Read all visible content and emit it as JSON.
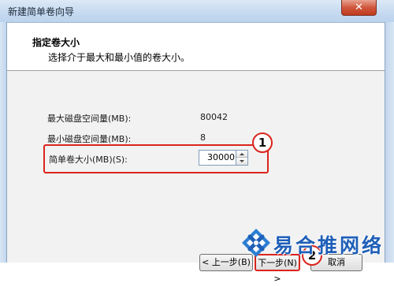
{
  "window": {
    "title": "新建简单卷向导",
    "close_symbol": "✕"
  },
  "header": {
    "title": "指定卷大小",
    "subtitle": "选择介于最大和最小值的卷大小。"
  },
  "fields": {
    "max_label": "最大磁盘空间量(MB):",
    "max_value": "80042",
    "min_label": "最小磁盘空间量(MB):",
    "min_value": "8",
    "size_label": "简单卷大小(MB)(S):",
    "size_value": "30000"
  },
  "callouts": {
    "one": "1",
    "two": "2"
  },
  "buttons": {
    "back": "< 上一步(B)",
    "next": "下一步(N) >",
    "cancel": "取消"
  },
  "watermark": {
    "text": "易合推网络"
  },
  "colors": {
    "highlight": "#d9251c",
    "watermark": "#1f5fb8"
  },
  "icons": {
    "close": "close-icon",
    "spin_up": "chevron-up-icon",
    "spin_down": "chevron-down-icon",
    "watermark_logo": "logo-icon"
  }
}
